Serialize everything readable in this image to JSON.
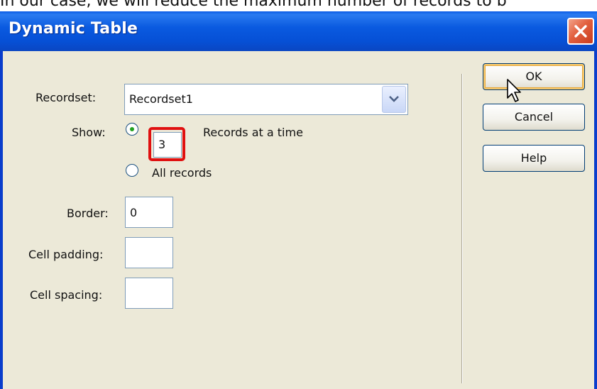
{
  "caption": {
    "text": "In our case, we will reduce the maximum number of records to b"
  },
  "window": {
    "title": "Dynamic Table",
    "close_icon": "close-icon"
  },
  "form": {
    "recordset": {
      "label": "Recordset:",
      "value": "Recordset1"
    },
    "show": {
      "label": "Show:",
      "count_value": "3",
      "records_label": "Records at a time",
      "all_records_label": "All records",
      "selected": "records-at-a-time"
    },
    "border": {
      "label": "Border:",
      "value": "0"
    },
    "cell_padding": {
      "label": "Cell padding:",
      "value": ""
    },
    "cell_spacing": {
      "label": "Cell spacing:",
      "value": ""
    }
  },
  "buttons": {
    "ok": "OK",
    "cancel": "Cancel",
    "help": "Help"
  },
  "colors": {
    "title_bar": "#0a5ae0",
    "dialog_bg": "#ece9d8",
    "highlight": "#e01010",
    "radio_dot": "#21a121"
  }
}
